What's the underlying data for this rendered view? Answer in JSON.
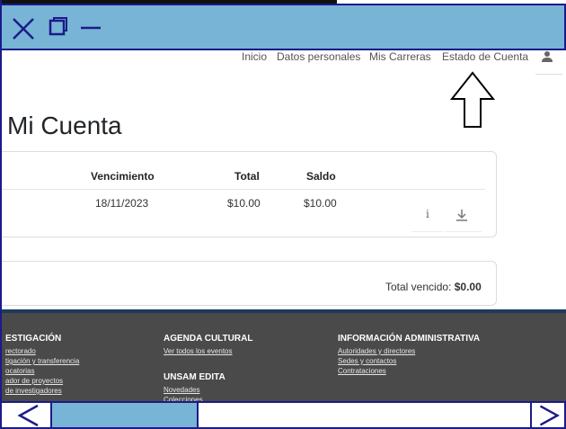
{
  "window": {
    "close_icon": "close-icon",
    "maximize_icon": "maximize-icon",
    "minimize_icon": "minimize-icon"
  },
  "nav": {
    "items": [
      "Inicio",
      "Datos personales",
      "Mis Carreras",
      "Estado de Cuenta"
    ],
    "user_icon": "user-icon"
  },
  "annotation": {
    "icon": "up-arrow-outline-icon"
  },
  "page": {
    "title": "Mi Cuenta"
  },
  "table": {
    "headers": [
      "Vencimiento",
      "Total",
      "Saldo"
    ],
    "rows": [
      {
        "vencimiento": "18/11/2023",
        "total": "$10.00",
        "saldo": "$10.00",
        "info_icon": "i",
        "download_icon": "download-icon"
      }
    ]
  },
  "summary": {
    "label": "Total vencido:",
    "value": "$0.00"
  },
  "footer": {
    "col1": {
      "heading": "ESTIGACIÓN",
      "links": [
        "rectorado",
        "tigación y transferencia",
        "ocatorias",
        "ador de proyectos",
        "de investigadores"
      ]
    },
    "col2": {
      "heading": "AGENDA CULTURAL",
      "links": [
        "Ver todos los eventos"
      ],
      "heading2": "UNSAM EDITA",
      "links2": [
        "Novedades",
        "Colecciones"
      ]
    },
    "col3": {
      "heading": "INFORMACIÓN ADMINISTRATIVA",
      "links": [
        "Autoridades y directores",
        "Sedes y contactos",
        "Contrataciones"
      ]
    }
  },
  "bottom": {
    "prev_icon": "chevron-left-icon",
    "next_icon": "chevron-right-icon"
  },
  "colors": {
    "chrome": "#78b4d6",
    "chrome_border": "#1b1b8a",
    "footer_bg": "#4a4a4a"
  }
}
